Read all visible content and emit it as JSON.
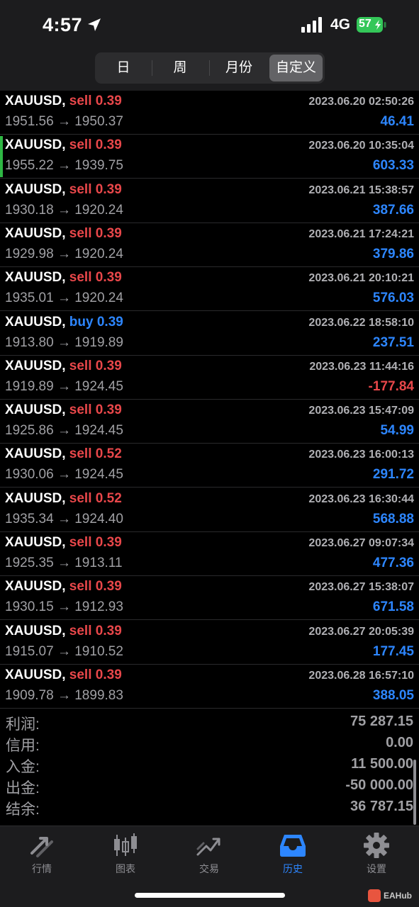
{
  "status_bar": {
    "time": "4:57",
    "network": "4G",
    "battery": "57",
    "icons": [
      "location-arrow-icon",
      "signal-icon",
      "battery-icon"
    ]
  },
  "period_tabs": [
    {
      "label": "日",
      "active": false
    },
    {
      "label": "周",
      "active": false
    },
    {
      "label": "月份",
      "active": false
    },
    {
      "label": "自定义",
      "active": true
    }
  ],
  "trades": [
    {
      "symbol": "XAUUSD,",
      "side": "sell",
      "volume": "0.39",
      "time": "2023.06.20 02:50:26",
      "prices": "1951.56 → 1950.37",
      "profit": "46.41",
      "negative": false,
      "highlight": false
    },
    {
      "symbol": "XAUUSD,",
      "side": "sell",
      "volume": "0.39",
      "time": "2023.06.20 10:35:04",
      "prices": "1955.22 → 1939.75",
      "profit": "603.33",
      "negative": false,
      "highlight": true
    },
    {
      "symbol": "XAUUSD,",
      "side": "sell",
      "volume": "0.39",
      "time": "2023.06.21 15:38:57",
      "prices": "1930.18 → 1920.24",
      "profit": "387.66",
      "negative": false,
      "highlight": false
    },
    {
      "symbol": "XAUUSD,",
      "side": "sell",
      "volume": "0.39",
      "time": "2023.06.21 17:24:21",
      "prices": "1929.98 → 1920.24",
      "profit": "379.86",
      "negative": false,
      "highlight": false
    },
    {
      "symbol": "XAUUSD,",
      "side": "sell",
      "volume": "0.39",
      "time": "2023.06.21 20:10:21",
      "prices": "1935.01 → 1920.24",
      "profit": "576.03",
      "negative": false,
      "highlight": false
    },
    {
      "symbol": "XAUUSD,",
      "side": "buy",
      "volume": "0.39",
      "time": "2023.06.22 18:58:10",
      "prices": "1913.80 → 1919.89",
      "profit": "237.51",
      "negative": false,
      "highlight": false
    },
    {
      "symbol": "XAUUSD,",
      "side": "sell",
      "volume": "0.39",
      "time": "2023.06.23 11:44:16",
      "prices": "1919.89 → 1924.45",
      "profit": "-177.84",
      "negative": true,
      "highlight": false
    },
    {
      "symbol": "XAUUSD,",
      "side": "sell",
      "volume": "0.39",
      "time": "2023.06.23 15:47:09",
      "prices": "1925.86 → 1924.45",
      "profit": "54.99",
      "negative": false,
      "highlight": false
    },
    {
      "symbol": "XAUUSD,",
      "side": "sell",
      "volume": "0.52",
      "time": "2023.06.23 16:00:13",
      "prices": "1930.06 → 1924.45",
      "profit": "291.72",
      "negative": false,
      "highlight": false
    },
    {
      "symbol": "XAUUSD,",
      "side": "sell",
      "volume": "0.52",
      "time": "2023.06.23 16:30:44",
      "prices": "1935.34 → 1924.40",
      "profit": "568.88",
      "negative": false,
      "highlight": false
    },
    {
      "symbol": "XAUUSD,",
      "side": "sell",
      "volume": "0.39",
      "time": "2023.06.27 09:07:34",
      "prices": "1925.35 → 1913.11",
      "profit": "477.36",
      "negative": false,
      "highlight": false
    },
    {
      "symbol": "XAUUSD,",
      "side": "sell",
      "volume": "0.39",
      "time": "2023.06.27 15:38:07",
      "prices": "1930.15 → 1912.93",
      "profit": "671.58",
      "negative": false,
      "highlight": false
    },
    {
      "symbol": "XAUUSD,",
      "side": "sell",
      "volume": "0.39",
      "time": "2023.06.27 20:05:39",
      "prices": "1915.07 → 1910.52",
      "profit": "177.45",
      "negative": false,
      "highlight": false
    },
    {
      "symbol": "XAUUSD,",
      "side": "sell",
      "volume": "0.39",
      "time": "2023.06.28 16:57:10",
      "prices": "1909.78 → 1899.83",
      "profit": "388.05",
      "negative": false,
      "highlight": false
    }
  ],
  "summary": [
    {
      "label": "利润:",
      "value": "75 287.15"
    },
    {
      "label": "信用:",
      "value": "0.00"
    },
    {
      "label": "入金:",
      "value": "11 500.00"
    },
    {
      "label": "出金:",
      "value": "-50 000.00"
    },
    {
      "label": "结余:",
      "value": "36 787.15"
    }
  ],
  "tab_bar": [
    {
      "label": "行情",
      "icon": "quotes-arrows-icon",
      "active": false
    },
    {
      "label": "图表",
      "icon": "candlestick-chart-icon",
      "active": false
    },
    {
      "label": "交易",
      "icon": "trade-trend-icon",
      "active": false
    },
    {
      "label": "历史",
      "icon": "history-inbox-icon",
      "active": true
    },
    {
      "label": "设置",
      "icon": "gear-icon",
      "active": false
    }
  ],
  "watermark": {
    "text": "EAHub"
  },
  "colors": {
    "background": "#000000",
    "bar_background": "#1c1c1e",
    "sell": "#e8474a",
    "buy": "#2d86ff",
    "profit_positive": "#2d86ff",
    "profit_negative": "#e8474a",
    "active_tab": "#2d86ff",
    "highlight_bar": "#2fb844",
    "battery": "#34c759"
  }
}
